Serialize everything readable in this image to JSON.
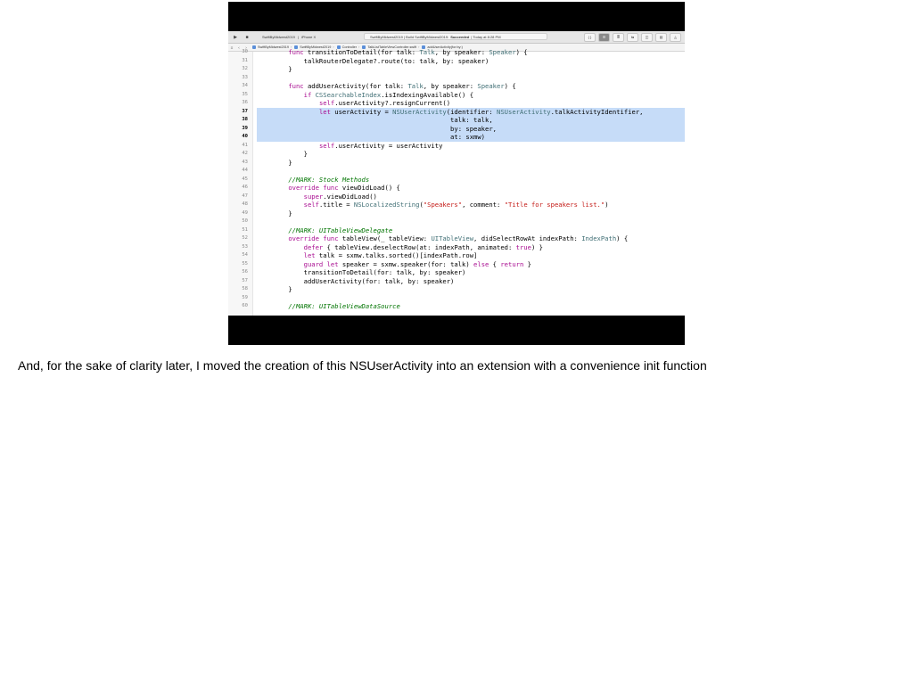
{
  "toolbar": {
    "scheme_project": "SwiftByMidwest2019",
    "scheme_device": "iPhone X",
    "status_project": "SwiftByMidwest2019 | Build SwiftByMidwest2019:",
    "status_result": "Succeeded",
    "status_time": "| Today at 8:28 PM"
  },
  "jumpbar": {
    "crumbs": [
      "SwiftByMidwest2019",
      "SwiftByMidwest2019",
      "Controller",
      "TalkListTableViewController.swift",
      "addUserActivity(for:by:)"
    ]
  },
  "code_lines": [
    {
      "num": "30",
      "text": "    func transitionToDetail(for talk: Talk, by speaker: Speaker) {",
      "sel": false
    },
    {
      "num": "31",
      "text": "        talkRouterDelegate?.route(to: talk, by: speaker)",
      "sel": false
    },
    {
      "num": "32",
      "text": "    }",
      "sel": false
    },
    {
      "num": "33",
      "text": "",
      "sel": false
    },
    {
      "num": "34",
      "text": "    func addUserActivity(for talk: Talk, by speaker: Speaker) {",
      "sel": false
    },
    {
      "num": "35",
      "text": "        if CSSearchableIndex.isIndexingAvailable() {",
      "sel": false
    },
    {
      "num": "36",
      "text": "            self.userActivity?.resignCurrent()",
      "sel": false
    },
    {
      "num": "37",
      "text": "            let userActivity = NSUserActivity(identifier: NSUserActivity.talkActivityIdentifier,",
      "sel": true
    },
    {
      "num": "38",
      "text": "                                              talk: talk,",
      "sel": true
    },
    {
      "num": "39",
      "text": "                                              by: speaker,",
      "sel": true
    },
    {
      "num": "40",
      "text": "                                              at: sxmw)",
      "sel": true
    },
    {
      "num": "41",
      "text": "            self.userActivity = userActivity",
      "sel": false
    },
    {
      "num": "42",
      "text": "        }",
      "sel": false
    },
    {
      "num": "43",
      "text": "    }",
      "sel": false
    },
    {
      "num": "44",
      "text": "",
      "sel": false
    },
    {
      "num": "45",
      "text": "    //MARK: Stock Methods",
      "sel": false
    },
    {
      "num": "46",
      "text": "    override func viewDidLoad() {",
      "sel": false
    },
    {
      "num": "47",
      "text": "        super.viewDidLoad()",
      "sel": false
    },
    {
      "num": "48",
      "text": "        self.title = NSLocalizedString(\"Speakers\", comment: \"Title for speakers list.\")",
      "sel": false
    },
    {
      "num": "49",
      "text": "    }",
      "sel": false
    },
    {
      "num": "50",
      "text": "",
      "sel": false
    },
    {
      "num": "51",
      "text": "    //MARK: UITableViewDelegate",
      "sel": false
    },
    {
      "num": "52",
      "text": "    override func tableView(_ tableView: UITableView, didSelectRowAt indexPath: IndexPath) {",
      "sel": false
    },
    {
      "num": "53",
      "text": "        defer { tableView.deselectRow(at: indexPath, animated: true) }",
      "sel": false
    },
    {
      "num": "54",
      "text": "        let talk = sxmw.talks.sorted()[indexPath.row]",
      "sel": false
    },
    {
      "num": "55",
      "text": "        guard let speaker = sxmw.speaker(for: talk) else { return }",
      "sel": false
    },
    {
      "num": "56",
      "text": "        transitionToDetail(for: talk, by: speaker)",
      "sel": false
    },
    {
      "num": "57",
      "text": "        addUserActivity(for: talk, by: speaker)",
      "sel": false
    },
    {
      "num": "58",
      "text": "    }",
      "sel": false
    },
    {
      "num": "59",
      "text": "",
      "sel": false
    },
    {
      "num": "60",
      "text": "    //MARK: UITableViewDataSource",
      "sel": false
    }
  ],
  "caption": "And, for the sake of clarity later, I moved the creation of this NSUserActivity into an extension with a convenience init function"
}
